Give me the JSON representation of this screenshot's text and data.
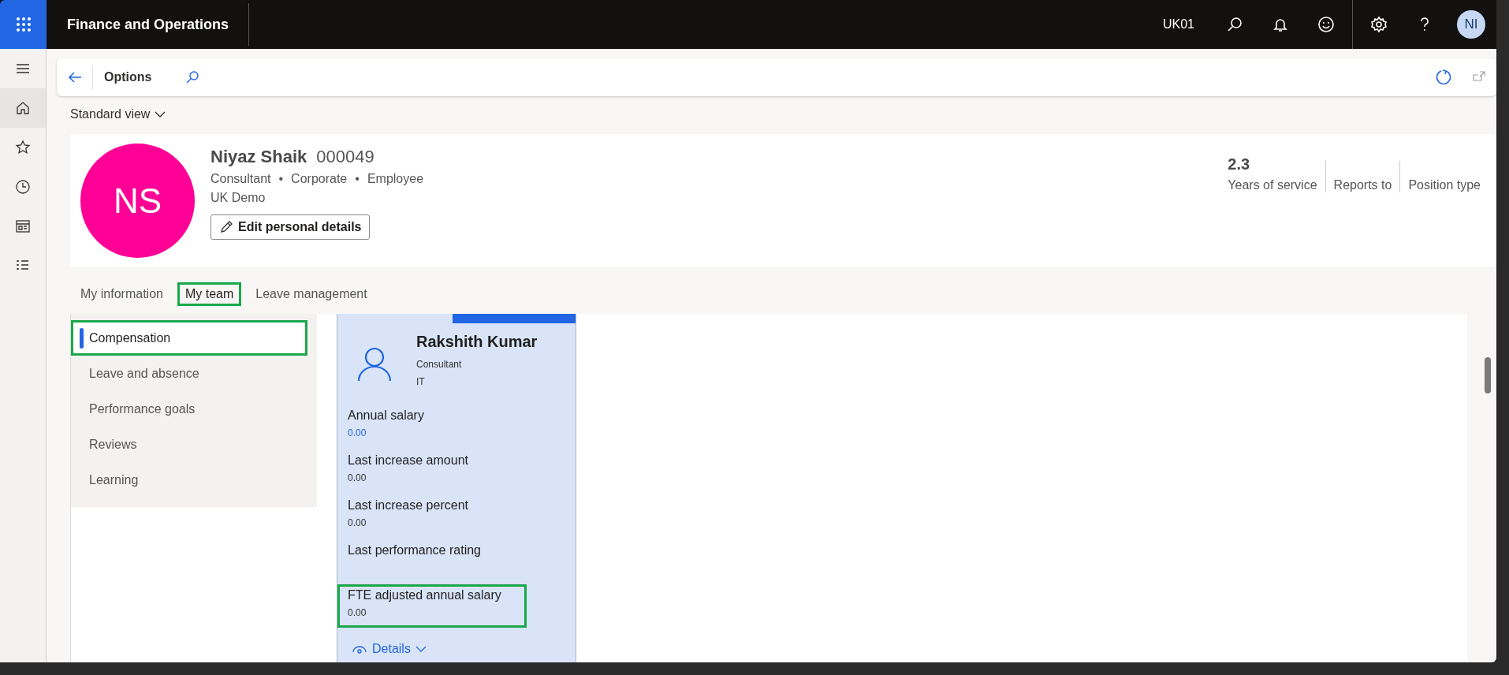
{
  "app_bar": {
    "title": "Finance and Operations",
    "company": "UK01",
    "user_initials": "NI"
  },
  "action_bar": {
    "title": "Options"
  },
  "view_selector": {
    "label": "Standard view"
  },
  "employee": {
    "initials": "NS",
    "name": "Niyaz Shaik",
    "number": "000049",
    "details": [
      "Consultant",
      "Corporate",
      "Employee"
    ],
    "separator": "•",
    "company": "UK Demo",
    "edit_button": "Edit personal details",
    "stats": [
      {
        "value": "2.3",
        "label": "Years of service"
      },
      {
        "label": "Reports to"
      },
      {
        "label": "Position type"
      }
    ]
  },
  "tabs": [
    {
      "label": "My information",
      "selected": false,
      "highlighted": false
    },
    {
      "label": "My team",
      "selected": true,
      "highlighted": true
    },
    {
      "label": "Leave management",
      "selected": false,
      "highlighted": false
    }
  ],
  "sidebar": {
    "items": [
      {
        "label": "Compensation",
        "selected": true,
        "highlighted": true
      },
      {
        "label": "Leave and absence",
        "selected": false,
        "highlighted": false
      },
      {
        "label": "Performance goals",
        "selected": false,
        "highlighted": false
      },
      {
        "label": "Reviews",
        "selected": false,
        "highlighted": false
      },
      {
        "label": "Learning",
        "selected": false,
        "highlighted": false
      }
    ]
  },
  "team_card": {
    "name": "Rakshith Kumar",
    "job": "Consultant",
    "department": "IT",
    "fields": [
      {
        "label": "Annual salary",
        "value": "0.00",
        "link": true,
        "highlighted": false
      },
      {
        "label": "Last increase amount",
        "value": "0.00",
        "link": false,
        "highlighted": false
      },
      {
        "label": "Last increase percent",
        "value": "0.00",
        "link": false,
        "highlighted": false
      },
      {
        "label": "Last performance rating",
        "highlighted": false
      },
      {
        "label": "FTE adjusted annual salary",
        "value": "0.00",
        "link": false,
        "highlighted": true
      }
    ],
    "details_link": "Details"
  }
}
